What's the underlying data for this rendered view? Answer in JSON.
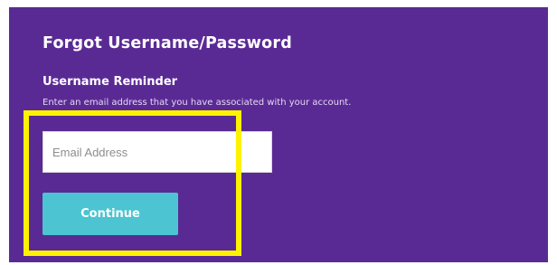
{
  "form": {
    "title": "Forgot Username/Password",
    "section_title": "Username Reminder",
    "helper_text": "Enter an email address that you have associated with your account.",
    "email_placeholder": "Email Address",
    "continue_label": "Continue"
  },
  "colors": {
    "panel_background": "#5a2a94",
    "button_background": "#4cc4d1",
    "highlight": "#fff200"
  }
}
